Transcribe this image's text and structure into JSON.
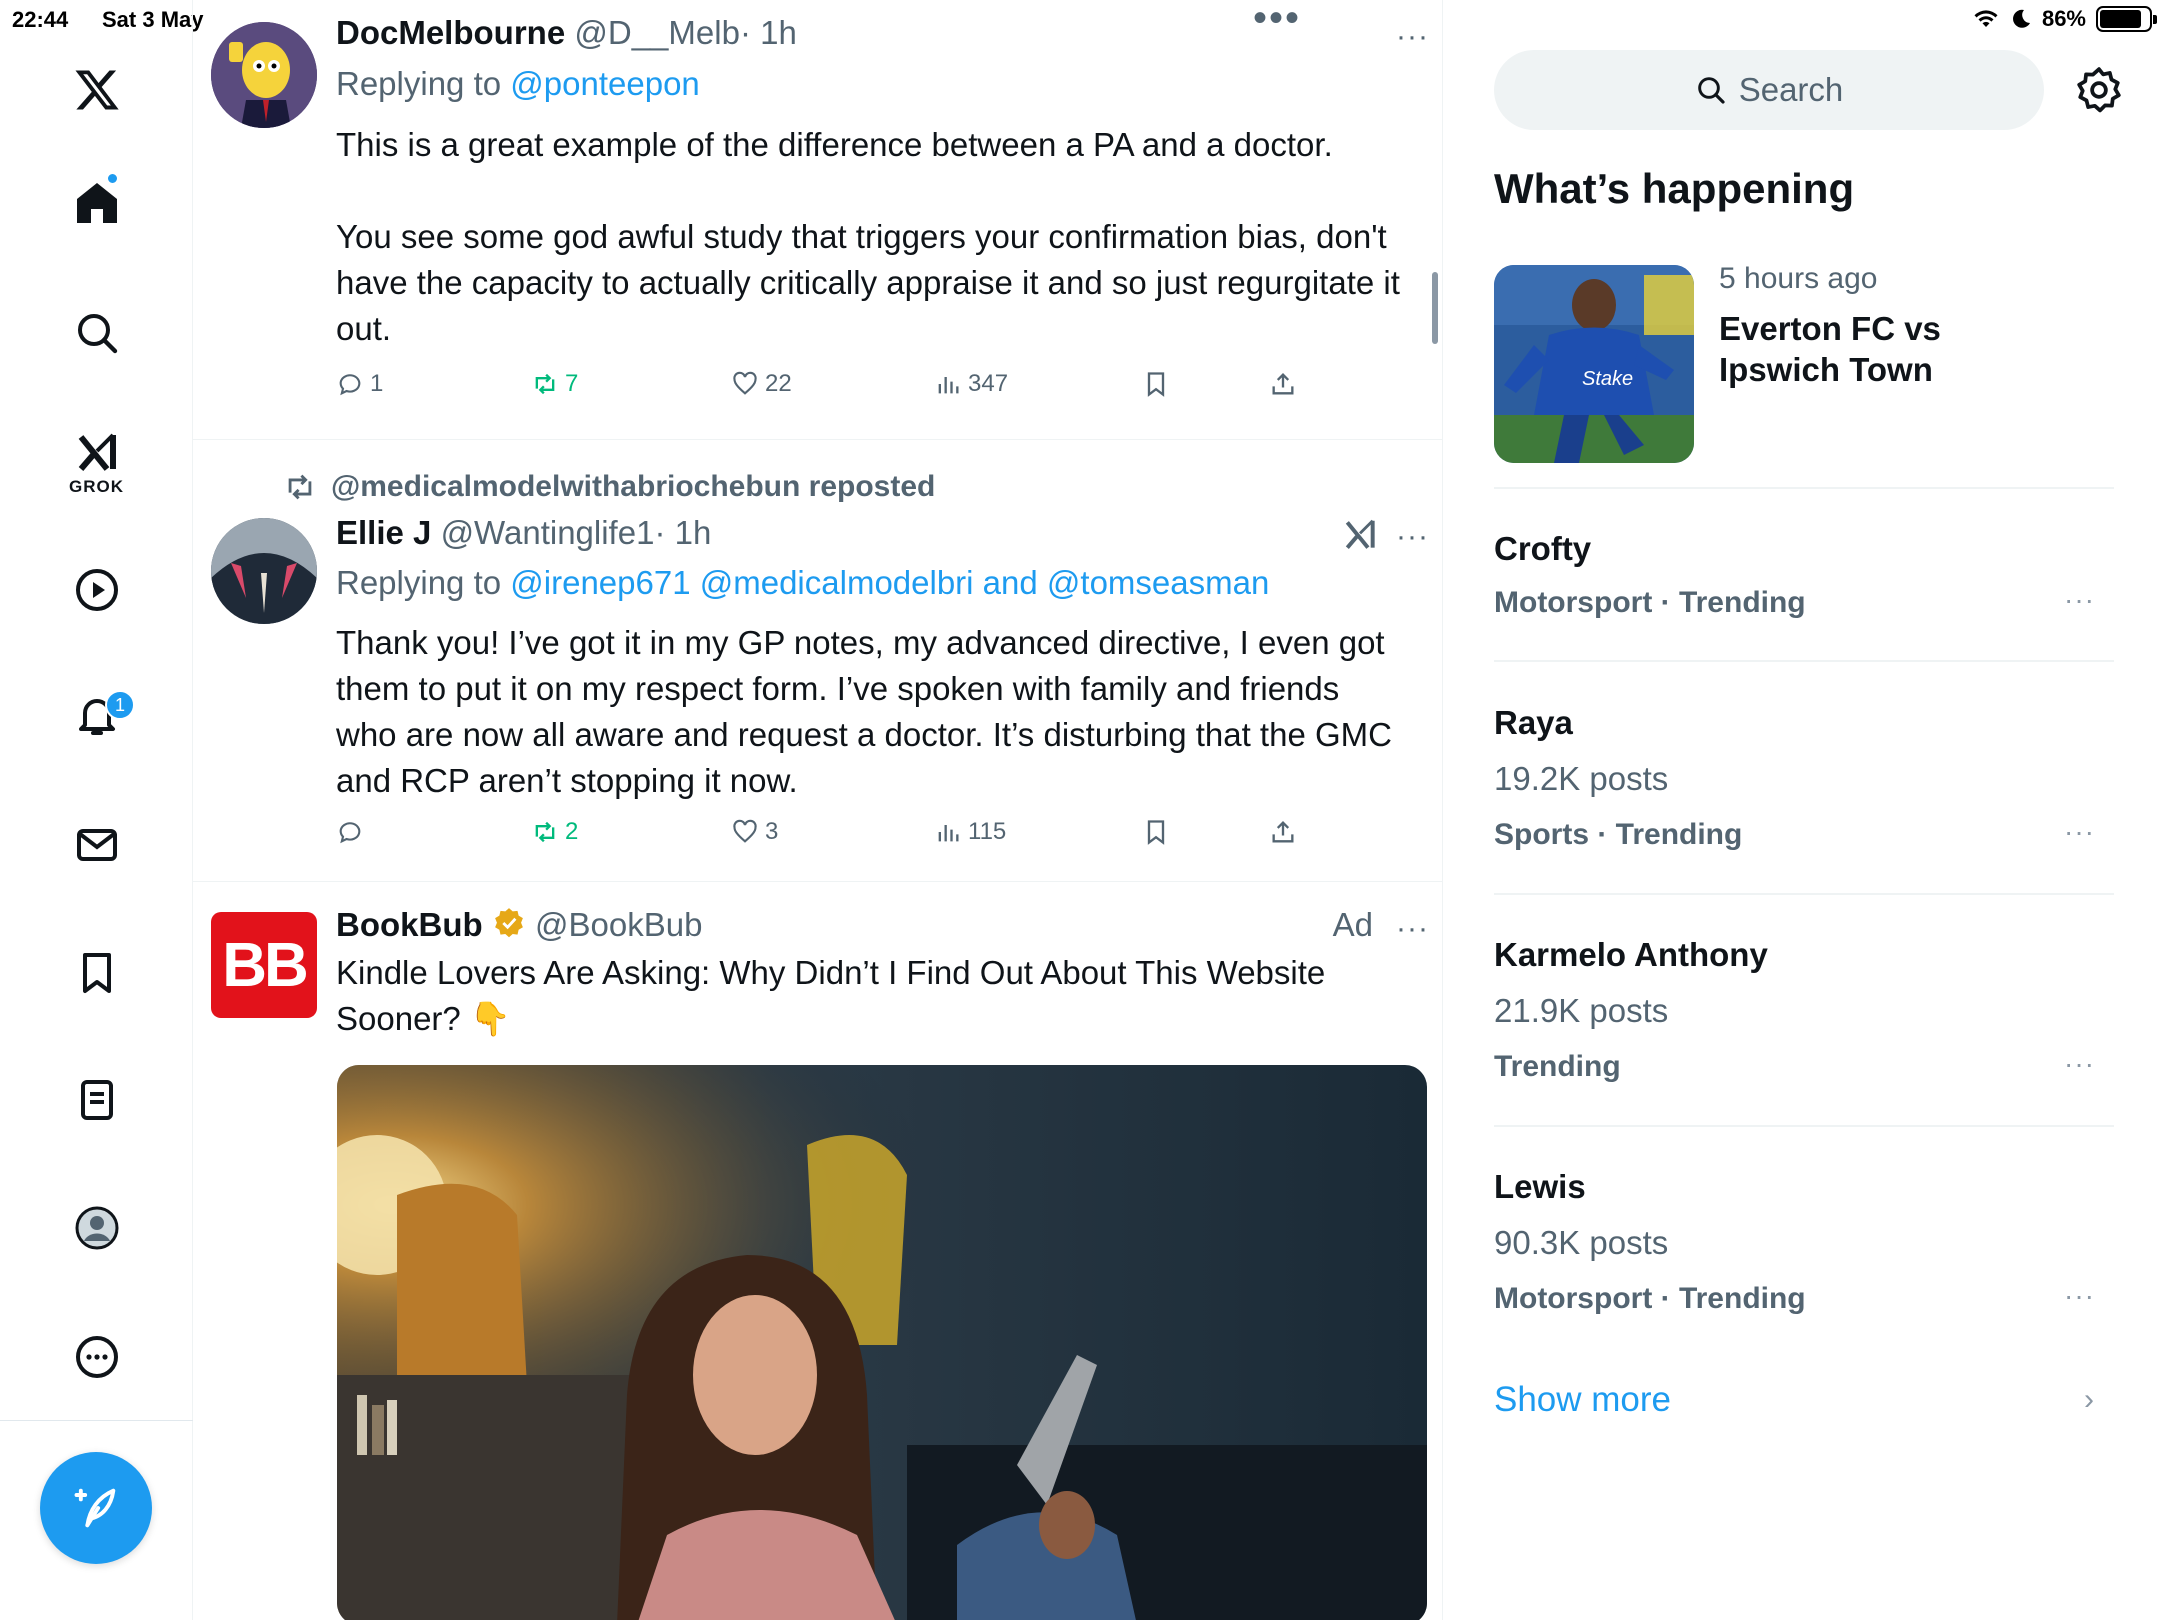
{
  "status_bar": {
    "time": "22:44",
    "date": "Sat 3 May",
    "battery": "86%",
    "battery_level": 0.86
  },
  "nav": {
    "grok_label": "GROK",
    "notifications_badge": "1"
  },
  "feed": {
    "tweets": [
      {
        "name": "DocMelbourne",
        "handle": "@D__Melb",
        "time": "· 1h",
        "replying_prefix": "Replying to",
        "replying_to": "@ponteepon",
        "text": "This is a great example of the difference between a PA and a doctor.\n\nYou see some god awful study that triggers your confirmation bias, don't have the capacity to actually critically appraise it and so just regurgitate it out.",
        "replies": "1",
        "reposts": "7",
        "likes": "22",
        "views": "347"
      },
      {
        "reposted_by": "@medicalmodelwithabriochebun reposted",
        "name": "Ellie J",
        "handle": "@Wantinglife1",
        "time": "· 1h",
        "replying_prefix": "Replying to",
        "replying_to": "@irenep671 @medicalmodelbri and @tomseasman",
        "text": "Thank you! I’ve got it in my GP notes, my advanced directive, I even got them to put it on my respect form. I’ve spoken with family and friends who are now all aware and request a doctor. It’s disturbing that the GMC and RCP aren’t stopping it now.",
        "replies": "",
        "reposts": "2",
        "likes": "3",
        "views": "115"
      },
      {
        "avatar_text": "BB",
        "name": "BookBub",
        "handle": "@BookBub",
        "ad_label": "Ad",
        "text": "Kindle Lovers Are Asking: Why Didn’t I Find Out About This Website Sooner? 👇"
      }
    ]
  },
  "sidebar": {
    "search_placeholder": "Search",
    "section_title": "What’s happening",
    "news": {
      "time": "5 hours ago",
      "title": "Everton FC vs Ipswich Town"
    },
    "trends": [
      {
        "name": "Crofty",
        "count": "",
        "meta": "Motorsport · Trending"
      },
      {
        "name": "Raya",
        "count": "19.2K posts",
        "meta": "Sports · Trending"
      },
      {
        "name": "Karmelo Anthony",
        "count": "21.9K posts",
        "meta": "Trending"
      },
      {
        "name": "Lewis",
        "count": "90.3K posts",
        "meta": "Motorsport · Trending"
      }
    ],
    "show_more": "Show more"
  },
  "colors": {
    "accent": "#1d9bf0",
    "repost_green": "#00ba7c",
    "muted": "#536471"
  }
}
